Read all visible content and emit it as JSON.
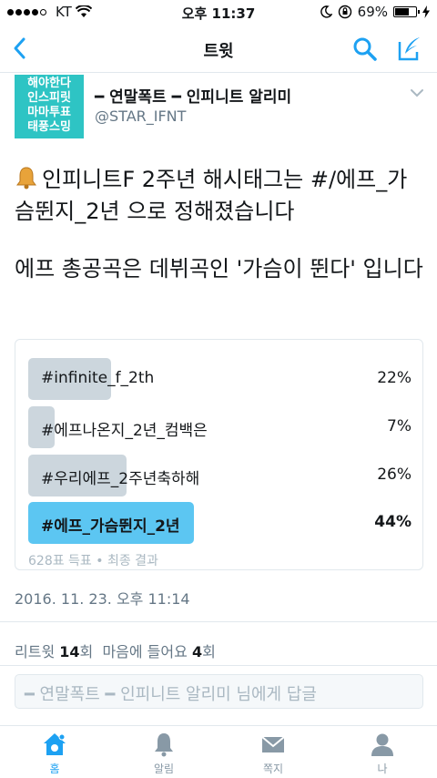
{
  "status_bar": {
    "carrier": "KT",
    "time": "오후 11:37",
    "battery": "69%",
    "battery_level": 0.69
  },
  "nav": {
    "title": "트윗",
    "back_icon": "chevron-left-icon",
    "search_icon": "search-icon",
    "compose_icon": "compose-icon"
  },
  "tweet": {
    "avatar_lines": [
      "해야한다",
      "인스피릿",
      "마마투표",
      "태풍스밍"
    ],
    "display_name": "━ 연말폭트 ━ 인피니트 알리미",
    "handle": "@STAR_IFNT",
    "text_line1": "인피니트F 2주년 해시태그는 #/에프_가슴뛴지_2년 으로 정해졌습니다",
    "text_line2": "에프 총공곡은 데뷔곡인 '가슴이 뛴다' 입니다",
    "date": "2016. 11. 23. 오후 11:14"
  },
  "poll": {
    "options": [
      {
        "label": "#infinite_f_2th",
        "percent": "22%",
        "fraction": 0.22
      },
      {
        "label": "#에프나온지_2년_컴백은",
        "percent": "7%",
        "fraction": 0.07
      },
      {
        "label": "#우리에프_2주년축하해",
        "percent": "26%",
        "fraction": 0.26
      },
      {
        "label": "#에프_가슴뛴지_2년",
        "percent": "44%",
        "fraction": 0.44
      }
    ],
    "meta": "628표 득표 • 최종 결과",
    "winner_color": "#5cc6f2",
    "bar_color": "#ccd6dd"
  },
  "stats": {
    "retweet_label": "리트윗",
    "retweet_count": "14",
    "retweet_unit": "회",
    "like_label": "마음에 들어요",
    "like_count": "4",
    "like_unit": "회"
  },
  "reply": {
    "placeholder": "━ 연말폭트 ━ 인피니트 알리미 님에게 답글"
  },
  "tabs": [
    {
      "label": "홈",
      "icon": "home-icon",
      "active": true
    },
    {
      "label": "알림",
      "icon": "bell-icon",
      "active": false
    },
    {
      "label": "쪽지",
      "icon": "envelope-icon",
      "active": false
    },
    {
      "label": "나",
      "icon": "person-icon",
      "active": false
    }
  ],
  "colors": {
    "accent": "#1da1f2",
    "avatar_bg": "#2ec4c4",
    "secondary_text": "#657786"
  }
}
